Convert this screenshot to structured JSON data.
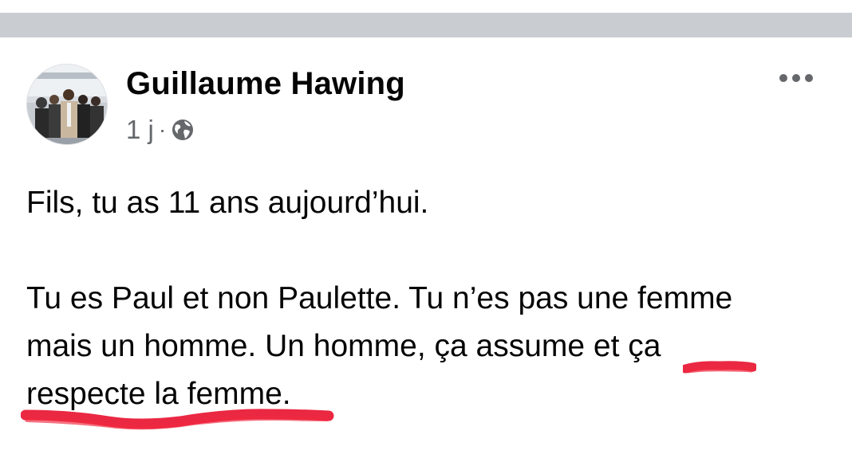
{
  "post": {
    "author": "Guillaume Hawing",
    "time": "1 j",
    "separator_dot": "·",
    "audience_icon": "globe-icon",
    "more_icon": "more-options-icon",
    "paragraphs": [
      [
        "Fils, tu as 11 ans aujourd’hui."
      ],
      [
        "Tu es Paul et non Paulette. Tu n’es pas une femme",
        "mais un homme. Un homme, ça assume et ça",
        "respecte la femme."
      ]
    ]
  },
  "annotations": {
    "underline_color": "#e8112d"
  },
  "colors": {
    "separator": "#c9ccd1",
    "meta_text": "#65676b",
    "text": "#050505"
  }
}
